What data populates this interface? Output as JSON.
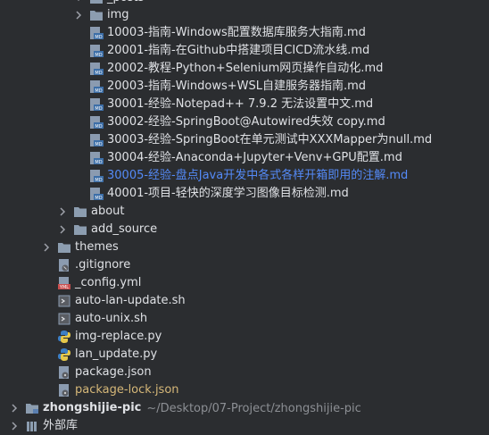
{
  "tree": {
    "top_partial": "_posts",
    "img_folder": "img",
    "md_files": [
      "10003-指南-Windows配置数据库服务大指南.md",
      "20001-指南-在Github中搭建项目CICD流水线.md",
      "20002-教程-Python+Selenium网页操作自动化.md",
      "20003-指南-Windows+WSL自建服务器指南.md",
      "30001-经验-Notepad++ 7.9.2 无法设置中文.md",
      "30002-经验-SpringBoot@Autowired失效 copy.md",
      "30003-经验-SpringBoot在单元测试中XXXMapper为null.md",
      "30004-经验-Anaconda+Jupyter+Venv+GPU配置.md",
      "30005-经验-盘点Java开发中各式各样开箱即用的注解.md",
      "40001-项目-轻快的深度学习图像目标检测.md"
    ],
    "folders_lvl2": [
      "about",
      "add_source"
    ],
    "themes": "themes",
    "root_files": [
      ".gitignore",
      "_config.yml",
      "auto-lan-update.sh",
      "auto-unix.sh",
      "img-replace.py",
      "lan_update.py",
      "package.json",
      "package-lock.json"
    ],
    "project_name": "zhongshijie-pic",
    "project_path": "~/Desktop/07-Project/zhongshijie-pic",
    "bottom_partial": "外部库"
  },
  "colors": {
    "background": "#2b2d30",
    "text": "#dfe1e5",
    "link": "#548af7",
    "modified": "#d5b778",
    "folder": "#8c9db0"
  }
}
